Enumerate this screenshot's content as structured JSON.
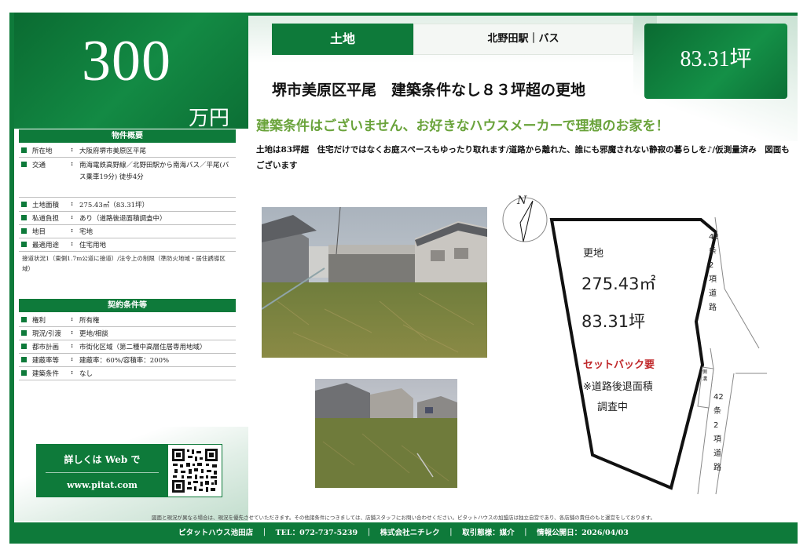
{
  "price": {
    "amount": "300",
    "unit": "万円"
  },
  "header": {
    "tag": "土地",
    "station": "北野田駅｜バス",
    "area": "83.31坪",
    "title": "堺市美原区平尾　建築条件なし８３坪超の更地",
    "catch": "建築条件はございません、お好きなハウスメーカーで理想のお家を！",
    "description": "土地は83坪超　住宅だけではなくお庭スペースもゆったり取れます/道路から離れた、誰にも邪魔されない静寂の暮らしを♪/仮測量済み　図面もございます"
  },
  "overview": {
    "heading": "物件概要",
    "rows": [
      {
        "label": "所在地",
        "value": "大阪府堺市美原区平尾"
      },
      {
        "label": "交通",
        "value": "南海電鉄高野線／北野田駅から南海バス／平尾(バス乗車19分) 徒歩4分"
      },
      {
        "label": "土地面積",
        "value": "275.43㎡（83.31坪）"
      },
      {
        "label": "私道負担",
        "value": "あり（道路後退面積調査中）"
      },
      {
        "label": "地目",
        "value": "宅地"
      },
      {
        "label": "最適用途",
        "value": "住宅用地"
      }
    ],
    "note": "接道状況1（東側1.7m公道に接道）/法令上の制限（準防火地域・居住誘導区域）"
  },
  "contract": {
    "heading": "契約条件等",
    "rows": [
      {
        "label": "権利",
        "value": "所有権"
      },
      {
        "label": "現況/引渡",
        "value": "更地/相談"
      },
      {
        "label": "都市計画",
        "value": "市街化区域（第二種中高層住居専用地域）"
      },
      {
        "label": "建蔽率等",
        "value": "建蔽率：60%/容積率：200%"
      },
      {
        "label": "建築条件",
        "value": "なし"
      }
    ]
  },
  "web": {
    "line1": "詳しくは Web で",
    "line2": "www.pitat.com"
  },
  "map": {
    "north": "N",
    "plot_label": "更地",
    "area_sqm": "275.43㎡",
    "area_tsubo": "83.31坪",
    "setback": "セットバック要",
    "note1": "※道路後退面積",
    "note2": "調査中",
    "road_upper": "42条2項道路",
    "road_lower": "42条2項道路",
    "small_label": "側溝"
  },
  "disclaimer": "図面と現況が異なる場合は、現況を優先させていただきます。その他諸条件につきましては、店舗スタッフにお問い合わせください。ピタットハウスの加盟店は独立自営であり、各店舗の責任のもと運営をしております。",
  "footer": "ピタットハウス池田店　｜　TEL：072-737-5239　｜　株式会社ニチレク　｜　取引態様：媒介　｜　情報公開日：2026/04/03",
  "colors": {
    "brand_green": "#0e7a3a",
    "catch_green": "#6aa33b",
    "setback_red": "#c0282a"
  }
}
